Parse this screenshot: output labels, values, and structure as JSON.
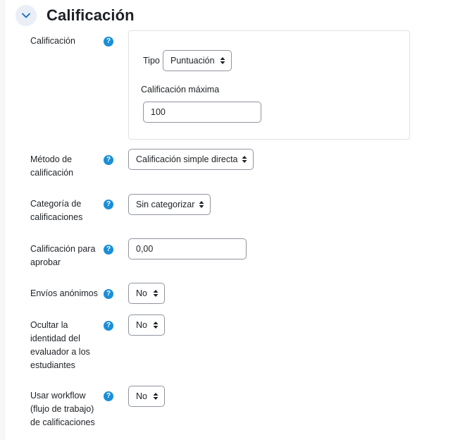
{
  "section": {
    "title": "Calificación"
  },
  "grade": {
    "label": "Calificación",
    "type_label": "Tipo",
    "type_value": "Puntuación",
    "max_label": "Calificación máxima",
    "max_value": "100"
  },
  "grading_method": {
    "label_line1": "Método de",
    "label_line2": "calificación",
    "value": "Calificación simple directa"
  },
  "grade_category": {
    "label_line1": "Categoría de",
    "label_line2": "calificaciones",
    "value": "Sin categorizar"
  },
  "grade_to_pass": {
    "label_line1": "Calificación para",
    "label_line2": "aprobar",
    "value": "0,00"
  },
  "anonymous": {
    "label": "Envíos anónimos",
    "value": "No"
  },
  "hide_grader": {
    "label_line1": "Ocultar la",
    "label_line2": "identidad del",
    "label_line3": "evaluador a los",
    "label_line4": "estudiantes",
    "value": "No"
  },
  "workflow": {
    "label_line1": "Usar workflow",
    "label_line2": "(flujo de trabajo)",
    "label_line3": "de calificaciones",
    "value": "No"
  },
  "help_glyph": "?",
  "colors": {
    "help": "#1a8fd8",
    "toggle_bg": "#e9eef7",
    "toggle_icon": "#0f6cbf",
    "border": "#8f959e"
  },
  "icons": {
    "toggle": "chevron-down-icon",
    "select_arrow": "sort-arrows-icon",
    "help": "question-circle-icon"
  }
}
